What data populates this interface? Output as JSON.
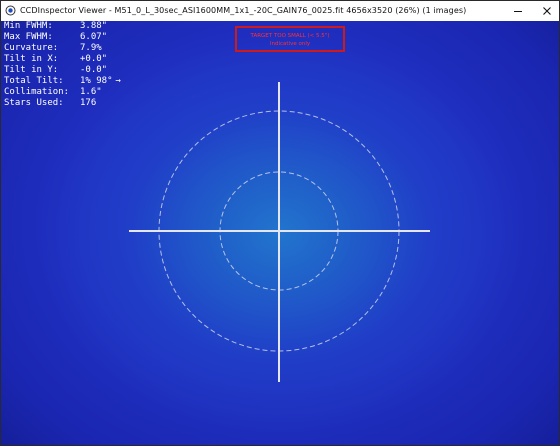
{
  "window": {
    "title": "CCDInspector Viewer - M51_0_L_30sec_ASI1600MM_1x1_-20C_GAIN76_0025.fit 4656x3520 (26%) (1 images)"
  },
  "stats": [
    {
      "label": "Min FWHM:",
      "value": "3.88\""
    },
    {
      "label": "Max FWHM:",
      "value": "6.07\""
    },
    {
      "label": "Curvature:",
      "value": "7.9%"
    },
    {
      "label": "Tilt in X:",
      "value": "+0.0\""
    },
    {
      "label": "Tilt in Y:",
      "value": "-0.0\""
    },
    {
      "label": "Total Tilt:",
      "value": "1% 98°",
      "extra": "→"
    },
    {
      "label": "Collimation:",
      "value": "1.6\""
    },
    {
      "label": "Stars Used:",
      "value": "176"
    }
  ],
  "warning": {
    "line1": "TARGET TOO SMALL (< 5.5\")",
    "line2": "Indicative only"
  },
  "colors": {
    "box_border": "#d01a1a",
    "crosshair": "#e6e6f0",
    "contour": "#cfd4ee",
    "field_center": "#1f78cd",
    "field_edge": "#070b48"
  },
  "icons": {
    "app": "ccdinspector-app-icon",
    "minimize": "minimize-icon",
    "close": "close-icon"
  }
}
